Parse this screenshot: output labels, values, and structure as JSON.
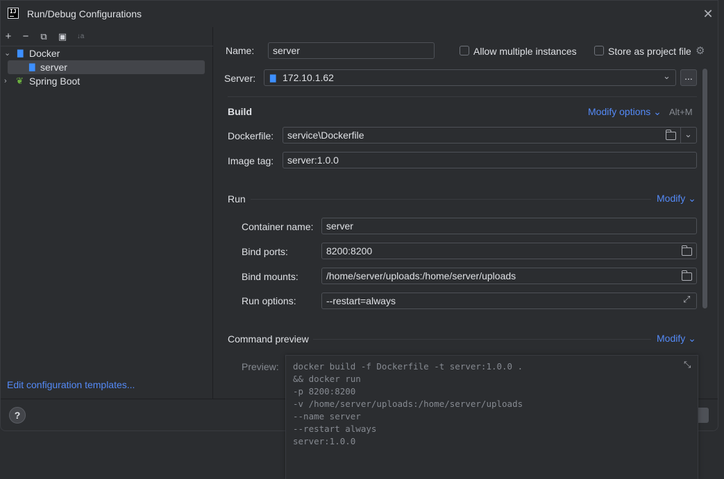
{
  "window": {
    "title": "Run/Debug Configurations",
    "app_icon": "IJ"
  },
  "toolbar": {
    "add": "+",
    "remove": "−",
    "copy": "⧉",
    "new_folder": "▣",
    "sort": "↓a"
  },
  "tree": {
    "groups": [
      {
        "label": "Docker",
        "expanded": true,
        "children": [
          {
            "label": "server",
            "selected": true
          }
        ]
      },
      {
        "label": "Spring Boot",
        "expanded": false
      }
    ]
  },
  "edit_templates": "Edit configuration templates...",
  "form": {
    "name_label": "Name:",
    "name_value": "server",
    "allow_multiple_label": "Allow multiple instances",
    "store_project_label": "Store as project file",
    "server_label": "Server:",
    "server_value": "172.10.1.62",
    "server_more": "...",
    "build": {
      "title": "Build",
      "modify_options": "Modify options",
      "shortcut": "Alt+M",
      "dockerfile_label": "Dockerfile:",
      "dockerfile_value": "service\\Dockerfile",
      "image_tag_label": "Image tag:",
      "image_tag_value": "server:1.0.0"
    },
    "run": {
      "title": "Run",
      "modify": "Modify",
      "container_name_label": "Container name:",
      "container_name_value": "server",
      "bind_ports_label": "Bind ports:",
      "bind_ports_value": "8200:8200",
      "bind_mounts_label": "Bind mounts:",
      "bind_mounts_value": "/home/server/uploads:/home/server/uploads",
      "run_options_label": "Run options:",
      "run_options_value": "--restart=always"
    },
    "command_preview": {
      "title": "Command preview",
      "modify": "Modify",
      "preview_label": "Preview:",
      "lines": [
        "docker build -f Dockerfile -t server:1.0.0 .",
        "&& docker run",
        "-p 8200:8200",
        "-v /home/server/uploads:/home/server/uploads",
        "--name server",
        "--restart always",
        "server:1.0.0"
      ]
    }
  },
  "help": "?",
  "colors": {
    "accent": "#548af7",
    "docker": "#3d8fff",
    "spring": "#6db33f",
    "background": "#2b2d30"
  }
}
